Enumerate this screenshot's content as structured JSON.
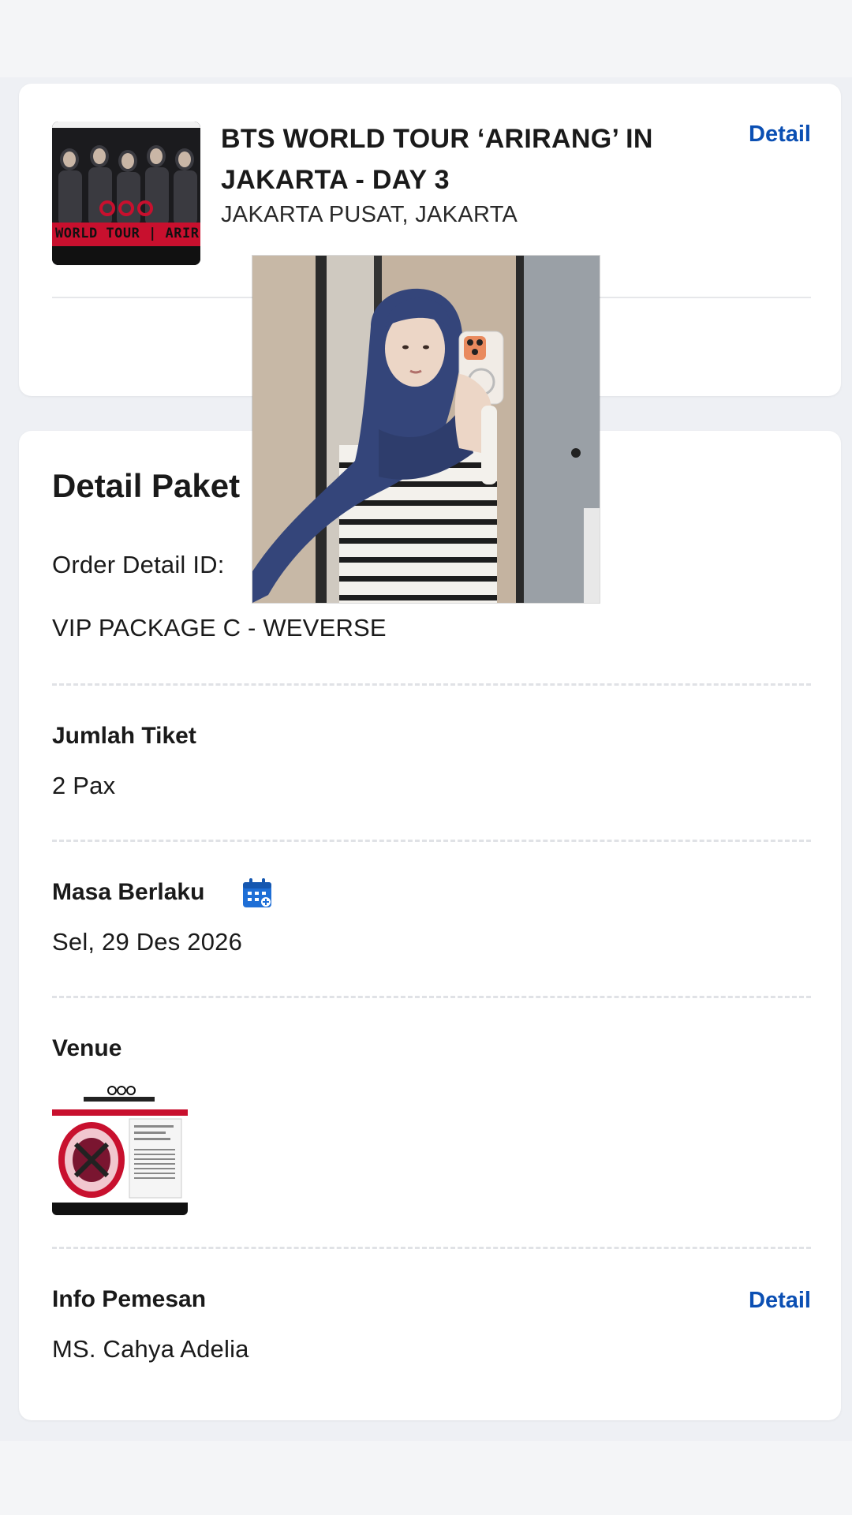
{
  "event": {
    "title": "BTS WORLD TOUR ‘ARIRANG’ IN JAKARTA - DAY 3",
    "location": "JAKARTA PUSAT, JAKARTA",
    "detail_link": "Detail",
    "poster_caption": "WORLD TOUR | ARIR"
  },
  "package": {
    "section_title": "Detail Paket",
    "order_label": "Order Detail ID:",
    "package_name": "VIP PACKAGE C - WEVERSE",
    "tickets_label": "Jumlah Tiket",
    "tickets_value": "2 Pax",
    "validity_label": "Masa Berlaku",
    "validity_value": "Sel, 29 Des 2026",
    "venue_label": "Venue",
    "orderer_label": "Info Pemesan",
    "orderer_detail_link": "Detail",
    "orderer_name": "MS. Cahya Adelia"
  },
  "icons": {
    "calendar": "calendar-icon"
  },
  "colors": {
    "accent": "#0b4fb3",
    "background": "#eef0f4",
    "card": "#ffffff",
    "poster_red": "#c8102e"
  }
}
